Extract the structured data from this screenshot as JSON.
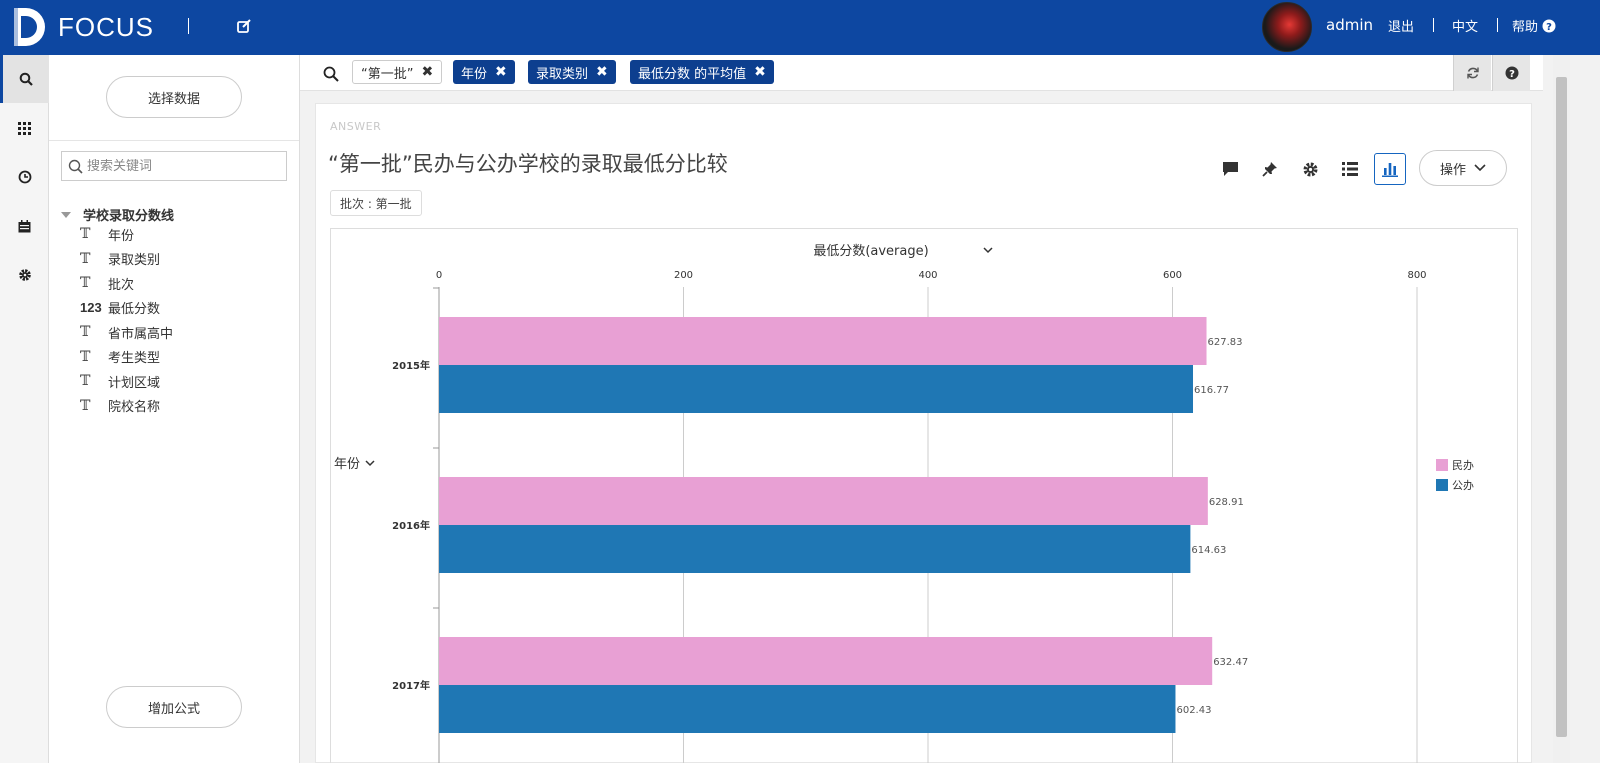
{
  "app": {
    "logo_text": "FOCUS"
  },
  "topbar": {
    "user": "admin",
    "logout": "退出",
    "language": "中文",
    "help": "帮助"
  },
  "sidebar": {
    "rail_icons": [
      "search-icon",
      "apps-grid-icon",
      "history-clock-icon",
      "calendar-icon",
      "settings-gear-icon"
    ],
    "select_data_label": "选择数据",
    "search_placeholder": "搜索关键词",
    "tree_root": "学校录取分数线",
    "fields": [
      {
        "type": "text",
        "type_glyph": "𝕋",
        "label": "年份"
      },
      {
        "type": "text",
        "type_glyph": "𝕋",
        "label": "录取类别"
      },
      {
        "type": "text",
        "type_glyph": "𝕋",
        "label": "批次"
      },
      {
        "type": "number",
        "type_glyph": "123",
        "label": "最低分数"
      },
      {
        "type": "text",
        "type_glyph": "𝕋",
        "label": "省市属高中"
      },
      {
        "type": "text",
        "type_glyph": "𝕋",
        "label": "考生类型"
      },
      {
        "type": "text",
        "type_glyph": "𝕋",
        "label": "计划区域"
      },
      {
        "type": "text",
        "type_glyph": "𝕋",
        "label": "院校名称"
      }
    ],
    "add_formula_label": "增加公式"
  },
  "query": {
    "tokens": [
      {
        "label": "“第一批”",
        "style": "plain"
      },
      {
        "label": "年份",
        "style": "dark"
      },
      {
        "label": "录取类别",
        "style": "dark"
      },
      {
        "label": "最低分数 的平均值",
        "style": "dark"
      }
    ]
  },
  "answer": {
    "section_label": "ANSWER",
    "title": "“第一批”民办与公办学校的录取最低分比较",
    "filter_tag": "批次 : 第一批",
    "operate_label": "操作",
    "tools": [
      "comment-icon",
      "pin-icon",
      "settings-icon",
      "table-view-icon",
      "bar-chart-icon"
    ]
  },
  "chart_data": {
    "type": "bar",
    "orientation": "horizontal",
    "xlabel": "最低分数(average)",
    "ylabel": "年份",
    "xlim": [
      0,
      800
    ],
    "x_ticks": [
      "0",
      "200",
      "400",
      "600",
      "800"
    ],
    "categories": [
      "2015年",
      "2016年",
      "2017年"
    ],
    "series": [
      {
        "name": "民办",
        "color": "#e8a0d4",
        "values": [
          627.83,
          628.91,
          632.47
        ],
        "labels": [
          "627.83",
          "628.91",
          "632.47"
        ]
      },
      {
        "name": "公办",
        "color": "#1f77b4",
        "values": [
          616.77,
          614.63,
          602.43
        ],
        "labels": [
          "616.77",
          "614.63",
          "602.43"
        ]
      }
    ],
    "grid": true,
    "legend_position": "right"
  }
}
